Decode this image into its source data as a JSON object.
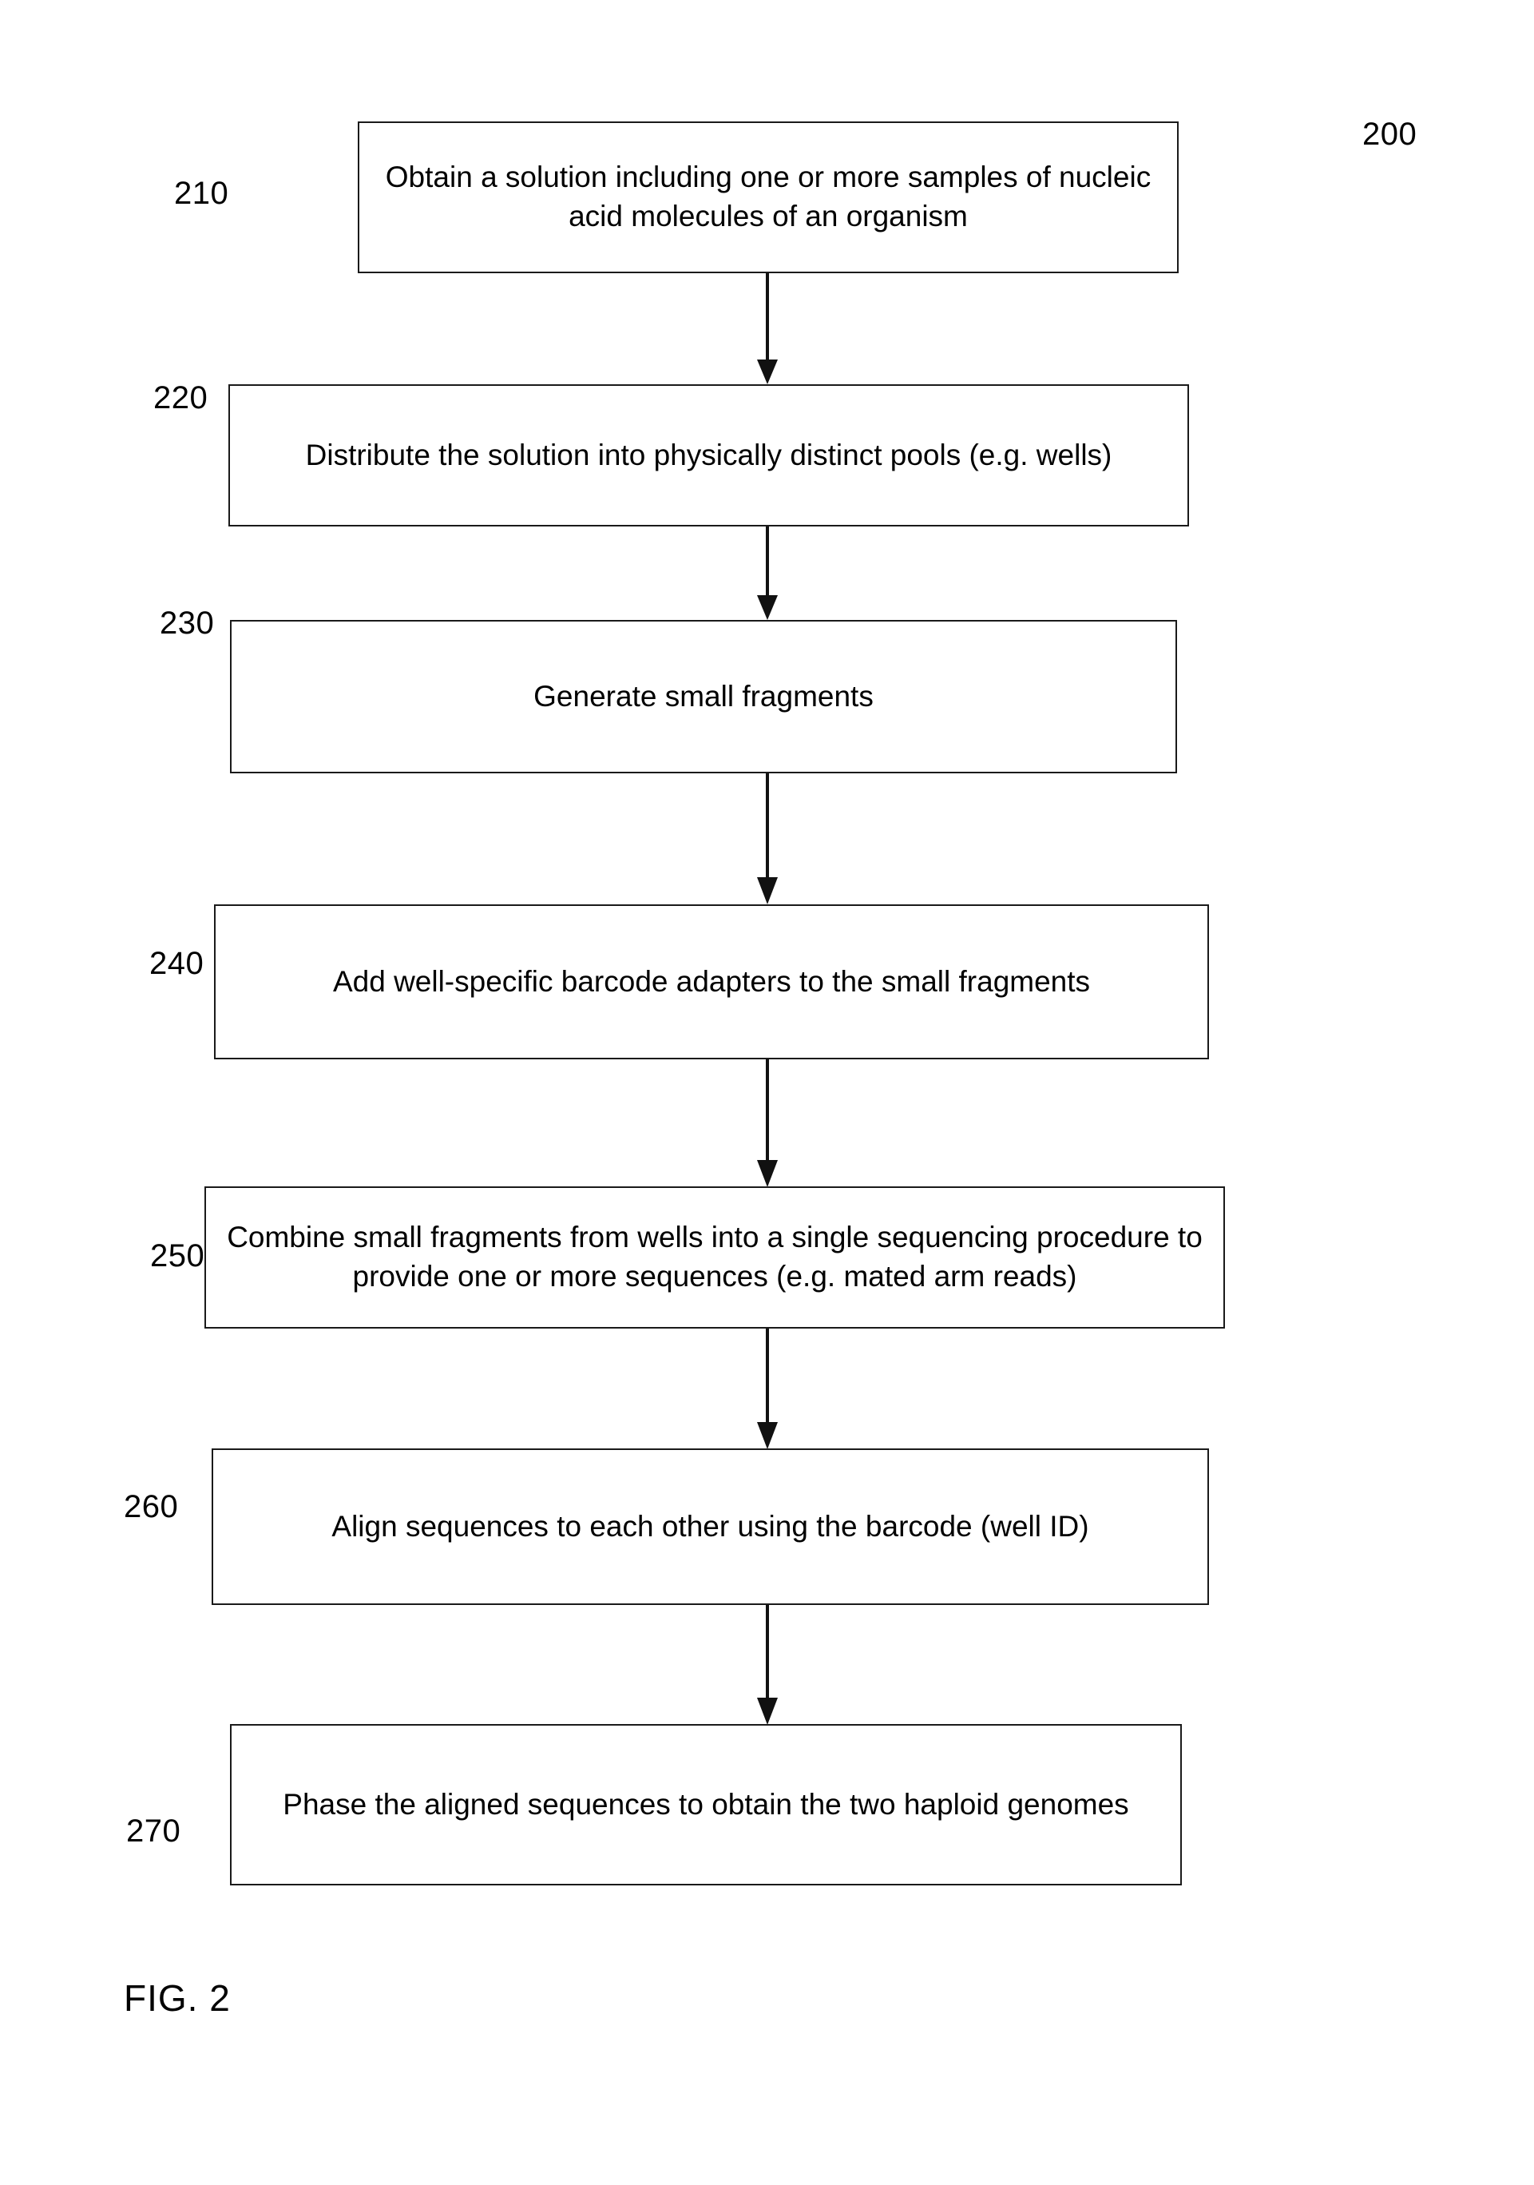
{
  "figure": {
    "caption": "FIG. 2",
    "diagram_reference": "200",
    "type": "flowchart",
    "orientation": "vertical-top-to-bottom"
  },
  "steps": [
    {
      "ref": "210",
      "text": "Obtain a solution including one or more samples of nucleic acid molecules of an organism"
    },
    {
      "ref": "220",
      "text": "Distribute the solution into physically distinct pools (e.g. wells)"
    },
    {
      "ref": "230",
      "text": "Generate small fragments"
    },
    {
      "ref": "240",
      "text": "Add well-specific barcode adapters to the small fragments"
    },
    {
      "ref": "250",
      "text": "Combine small fragments from wells into a single sequencing procedure to provide one or more sequences (e.g. mated arm reads)"
    },
    {
      "ref": "260",
      "text": "Align sequences to each other using the barcode (well ID)"
    },
    {
      "ref": "270",
      "text": "Phase the aligned sequences to obtain the two haploid genomes"
    }
  ],
  "colors": {
    "background": "#ffffff",
    "stroke": "#1a1a1a",
    "text": "#000000"
  }
}
